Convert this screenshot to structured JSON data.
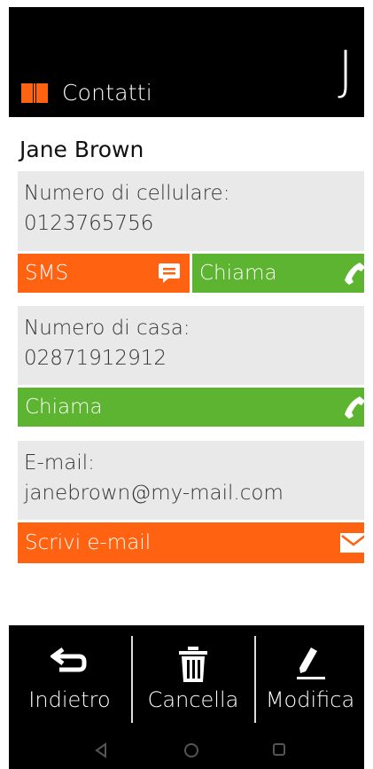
{
  "header": {
    "title": "Contatti",
    "initial": "J",
    "book_icon": "book-icon",
    "accent_color": "#ff6210"
  },
  "contact": {
    "name": "Jane Brown",
    "mobile": {
      "label": "Numero di cellulare:",
      "value": "0123765756",
      "sms_label": "SMS",
      "call_label": "Chiama"
    },
    "home": {
      "label": "Numero di casa:",
      "value": "02871912912",
      "call_label": "Chiama"
    },
    "email": {
      "label": "E-mail:",
      "value": "janebrown@my-mail.com",
      "write_label": "Scrivi e-mail"
    }
  },
  "bottom_nav": {
    "back_label": "Indietro",
    "delete_label": "Cancella",
    "edit_label": "Modifica"
  },
  "colors": {
    "orange": "#ff6210",
    "green": "#5db430",
    "field_bg": "#e9e9e9"
  }
}
